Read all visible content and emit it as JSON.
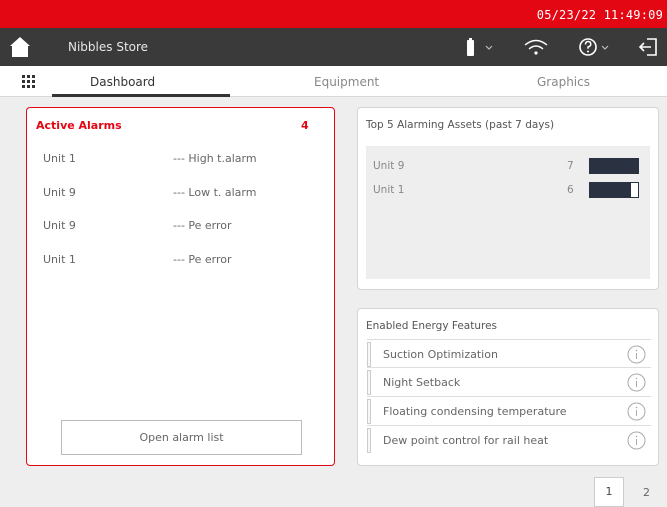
{
  "statusbar": {
    "datetime": "05/23/22 11:49:09"
  },
  "header": {
    "store_name": "Nibbles Store"
  },
  "tabs": [
    {
      "label": "Dashboard"
    },
    {
      "label": "Equipment"
    },
    {
      "label": "Graphics"
    }
  ],
  "alarms": {
    "title": "Active Alarms",
    "count": "4",
    "items": [
      {
        "unit": "Unit 1",
        "desc": "--- High t.alarm"
      },
      {
        "unit": "Unit 9",
        "desc": "--- Low t. alarm"
      },
      {
        "unit": "Unit 9",
        "desc": "--- Pe error"
      },
      {
        "unit": "Unit 1",
        "desc": "--- Pe error"
      }
    ],
    "open_button": "Open alarm list"
  },
  "assets": {
    "title": "Top 5 Alarming Assets (past 7 days)",
    "items": [
      {
        "name": "Unit 9",
        "value": "7",
        "fraction": 1.0
      },
      {
        "name": "Unit 1",
        "value": "6",
        "fraction": 0.857
      }
    ]
  },
  "energy": {
    "title": "Enabled Energy Features",
    "items": [
      {
        "label": "Suction Optimization"
      },
      {
        "label": "Night Setback"
      },
      {
        "label": "Floating condensing temperature"
      },
      {
        "label": "Dew point control for rail heat"
      }
    ]
  },
  "pagination": {
    "current": "1",
    "next": "2"
  },
  "colors": {
    "brand_red": "#e30613",
    "topbar": "#3a3a3a",
    "bar_fill": "#2a3140"
  },
  "icons": [
    "home-icon",
    "battery-icon",
    "wifi-icon",
    "help-icon",
    "logout-icon",
    "app-grid-icon",
    "info-icon"
  ]
}
